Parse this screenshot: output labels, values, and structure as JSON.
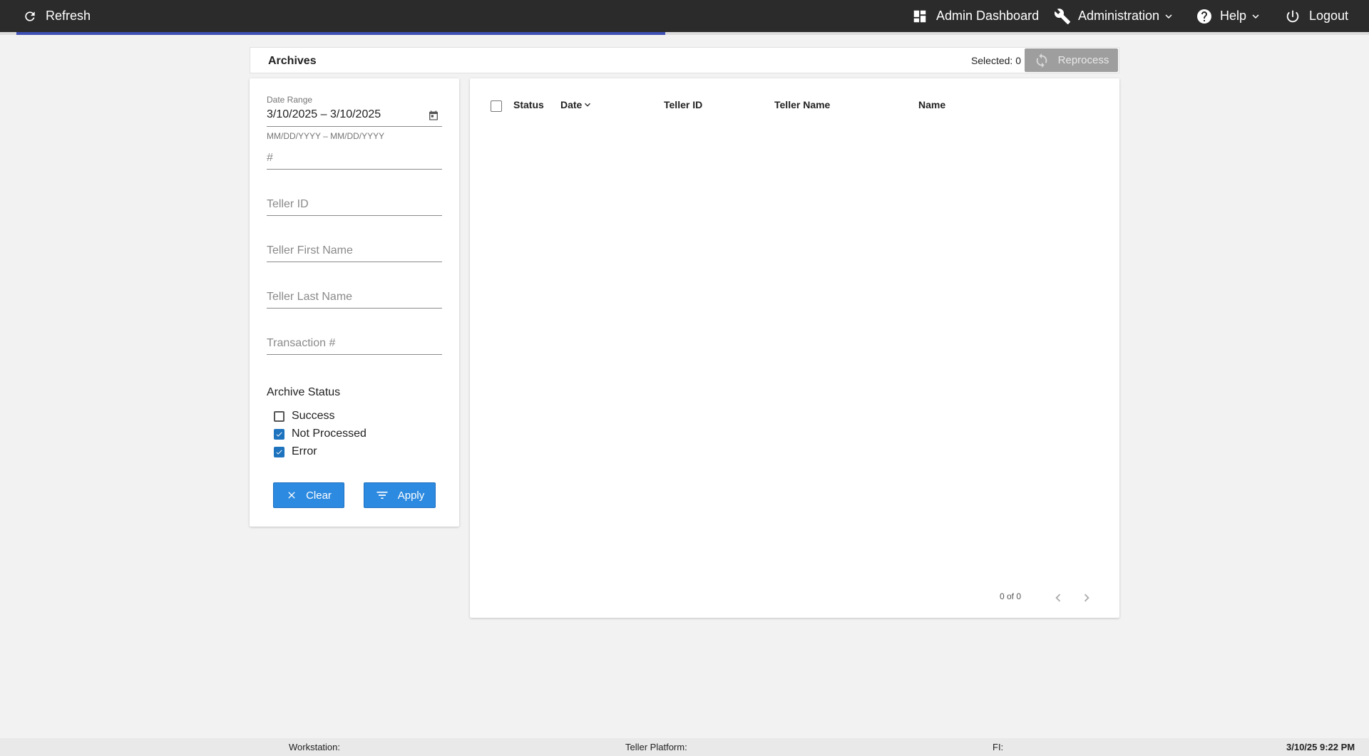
{
  "topbar": {
    "refresh_label": "Refresh",
    "admin_dashboard_label": "Admin Dashboard",
    "administration_label": "Administration",
    "help_label": "Help",
    "logout_label": "Logout",
    "progress_fraction": 0.474
  },
  "header": {
    "title": "Archives",
    "selected_label": "Selected: 0",
    "reprocess_label": "Reprocess"
  },
  "filters": {
    "date_range_label": "Date Range",
    "date_range_value": "3/10/2025 – 3/10/2025",
    "date_range_hint": "MM/DD/YYYY – MM/DD/YYYY",
    "number_placeholder": "#",
    "teller_id_placeholder": "Teller ID",
    "teller_first_name_placeholder": "Teller First Name",
    "teller_last_name_placeholder": "Teller Last Name",
    "transaction_placeholder": "Transaction #",
    "archive_status_heading": "Archive Status",
    "status_options": [
      {
        "label": "Success",
        "checked": false
      },
      {
        "label": "Not Processed",
        "checked": true
      },
      {
        "label": "Error",
        "checked": true
      }
    ],
    "clear_label": "Clear",
    "apply_label": "Apply"
  },
  "table": {
    "columns": [
      "Status",
      "Date",
      "Teller ID",
      "Teller Name",
      "Name"
    ],
    "rows": [],
    "paginator_range": "0 of 0"
  },
  "footer": {
    "workstation": "Workstation:",
    "teller_platform": "Teller Platform:",
    "fi": "FI:",
    "datetime": "3/10/25 9:22 PM"
  },
  "colors": {
    "topbar": "#2b2b2b",
    "progress": "#3f51b5",
    "primary_button": "#2c8ae0",
    "disabled_button": "#9e9e9e"
  }
}
